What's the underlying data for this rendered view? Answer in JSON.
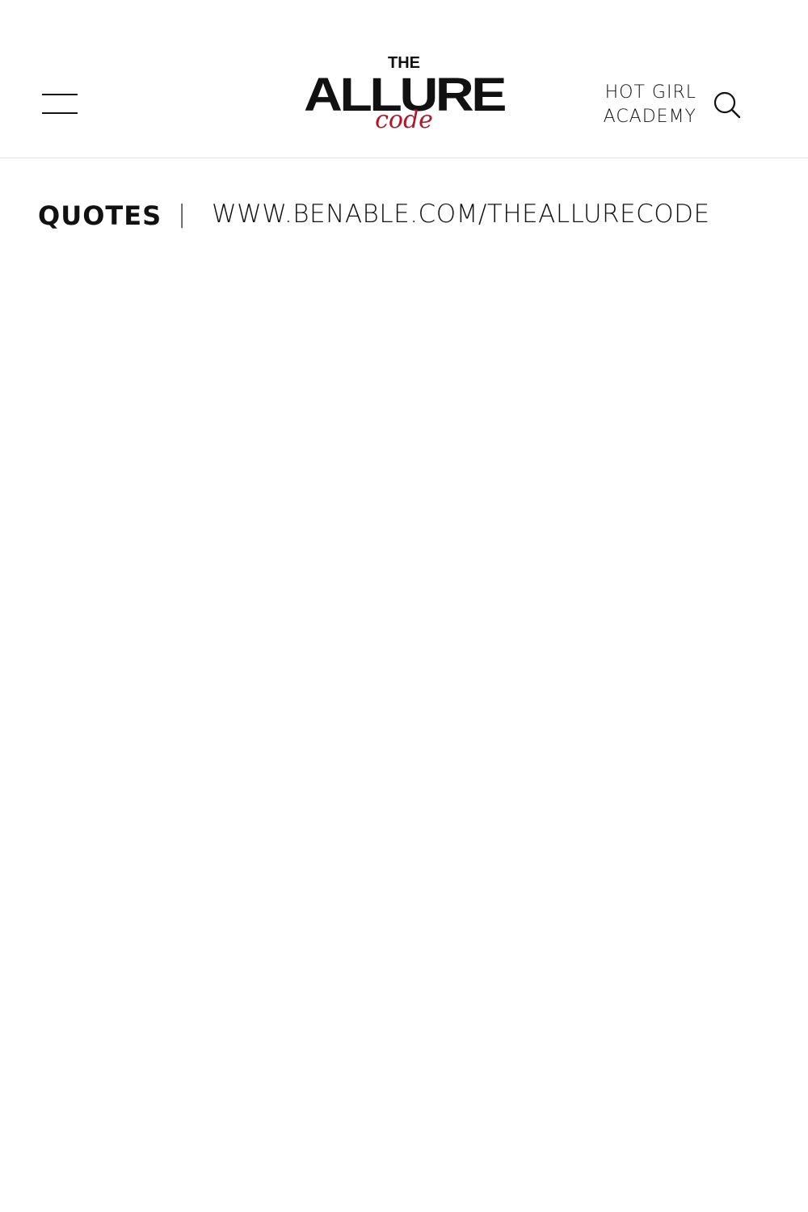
{
  "header": {
    "menu_icon": "hamburger-menu-icon",
    "logo": {
      "line1": "THE",
      "line2": "ALLURE",
      "line3": "code",
      "accent_color": "#b0172a"
    },
    "nav_link": {
      "line1": "HOT GIRL",
      "line2": "ACADEMY"
    },
    "search_icon": "search-icon"
  },
  "breadcrumb": {
    "title": "QUOTES",
    "separator": "|",
    "link": "WWW.BENABLE.COM/THEALLURECODE"
  }
}
